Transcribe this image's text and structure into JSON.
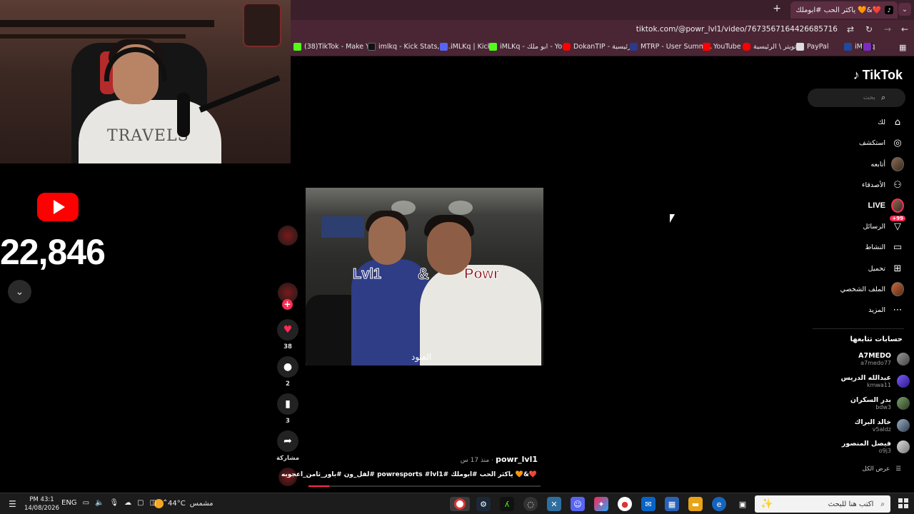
{
  "youtube": {
    "subscriber_count": "22,846"
  },
  "webcam": {
    "shirt_text": "TRAVELS"
  },
  "browser": {
    "tab_title": "❤️&🧡 ياكثر الحب #ابوملك",
    "url": "tiktok.com/@powr_lvl1/video/7673567164426685716",
    "bookmarks": [
      {
        "label": "(38)TikTok - Make Y...",
        "color": "#53fc18"
      },
      {
        "label": "imlkq - Kick Stats, A...",
        "color": "#111111"
      },
      {
        "label": "iMLKq | Kick",
        "color": "#5865f2"
      },
      {
        "label": "iMLKq - ابو ملك - Yo...",
        "color": "#53fc18"
      },
      {
        "label": "DokanTIP - الرئيسية",
        "color": "#ff0000"
      },
      {
        "label": "MTRP - User Summ...",
        "color": "#2b3a8a"
      },
      {
        "label": "YouTube",
        "color": "#ff0000"
      },
      {
        "label": "تويتر \\ الرئيسية",
        "color": "#ff0000"
      },
      {
        "label": "PayPal",
        "color": "#dddddd"
      },
      {
        "label": "iMLKq",
        "color": "#1e4aa0"
      }
    ]
  },
  "tiktok": {
    "logo": "TikTok",
    "search_placeholder": "بحث",
    "nav": [
      {
        "label": "لك",
        "icon": "home-icon"
      },
      {
        "label": "استكشف",
        "icon": "compass-icon"
      },
      {
        "label": "أتابعه",
        "icon": "avatar"
      },
      {
        "label": "الأصدقاء",
        "icon": "friends-icon"
      },
      {
        "label": "LIVE",
        "icon": "live-avatar"
      },
      {
        "label": "الرسائل",
        "icon": "inbox-icon",
        "badge": "99+"
      },
      {
        "label": "النشاط",
        "icon": "activity-icon"
      },
      {
        "label": "تحميل",
        "icon": "upload-icon"
      },
      {
        "label": "الملف الشخصي",
        "icon": "profile-avatar"
      },
      {
        "label": "المزيد",
        "icon": "more-icon"
      }
    ],
    "following_title": "حسابات تتابعها",
    "following": [
      {
        "name": "A7MEDO",
        "handle": "a7medo77"
      },
      {
        "name": "عبدالله الدريس",
        "handle": "kmwa11"
      },
      {
        "name": "بدر السكران",
        "handle": "bdw3"
      },
      {
        "name": "خالد البراك",
        "handle": "v5aldz"
      },
      {
        "name": "فيصل المنصور",
        "handle": "o9j3"
      }
    ],
    "see_all": "عرض الكل",
    "video": {
      "caption_left": "Lvl1",
      "caption_amp": "&",
      "caption_right": "Powr",
      "subtitle": "العنود",
      "author": "powr_lvl1",
      "ago": "· منذ 17 س",
      "description": "❤️&🧡 ياكثر الحب #ابوملك #powresports #lvl1 #لفل_ون #باور_ثامن_اعجوبه",
      "likes": "38",
      "comments": "2",
      "saves": "3",
      "share_label": "مشاركة",
      "progress_percent": 9
    }
  },
  "taskbar": {
    "search_placeholder": "اكتب هنا للبحث",
    "weather_temp": "44°C",
    "weather_label": "مشمس",
    "language": "ENG",
    "time": "PM 43:1",
    "date": "14/08/2026"
  }
}
